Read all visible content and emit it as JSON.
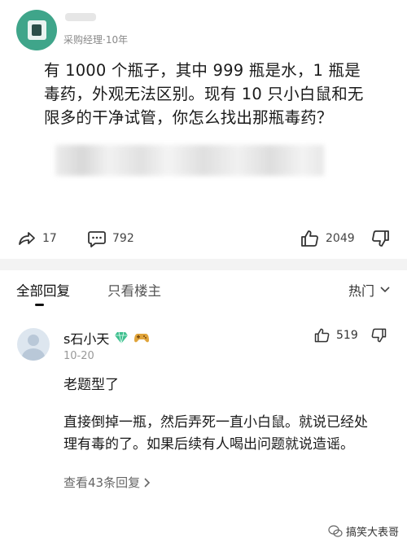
{
  "post": {
    "author_meta": "采购经理·10年",
    "question": "有 1000 个瓶子，其中 999 瓶是水，1 瓶是毒药，外观无法区别。现有 10 只小白鼠和无限多的干净试管，你怎么找出那瓶毒药？",
    "shares": "17",
    "comments": "792",
    "likes": "2049"
  },
  "tabs": {
    "all_replies": "全部回复",
    "only_op": "只看楼主",
    "sort_label": "热门"
  },
  "comment": {
    "username": "s石小天",
    "date": "10-20",
    "likes": "519",
    "line1": "老题型了",
    "body": "直接倒掉一瓶，然后弄死一直小白鼠。就说已经处理有毒的了。如果后续有人喝出问题就说造谣。",
    "view_replies": "查看43条回复"
  },
  "watermark": {
    "text": "搞笑大表哥"
  },
  "colors": {
    "avatar_green": "#3fa58a",
    "badge_green": "#3fbf8f",
    "text_dark": "#1a1a1a",
    "text_muted": "#888888"
  }
}
